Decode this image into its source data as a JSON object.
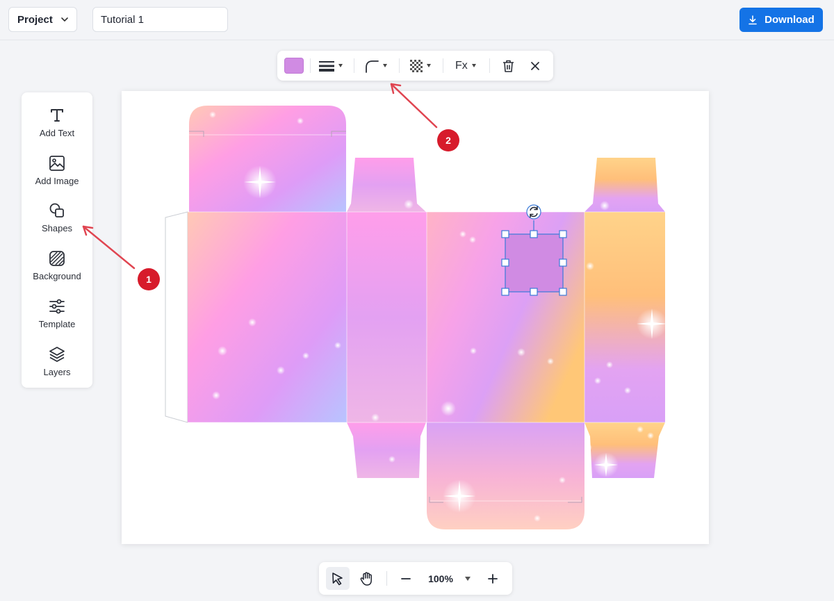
{
  "header": {
    "project_label": "Project",
    "title_value": "Tutorial 1",
    "download_label": "Download",
    "accent_color": "#1473e6"
  },
  "left_panel": {
    "items": [
      {
        "label": "Add Text",
        "icon": "text-icon"
      },
      {
        "label": "Add Image",
        "icon": "image-icon"
      },
      {
        "label": "Shapes",
        "icon": "shapes-icon"
      },
      {
        "label": "Background",
        "icon": "background-icon"
      },
      {
        "label": "Template",
        "icon": "sliders-icon"
      },
      {
        "label": "Layers",
        "icon": "layers-icon"
      }
    ]
  },
  "shape_toolbar": {
    "fill_color": "#d08be3",
    "fx_label": "Fx",
    "icons": [
      "fill-color-swatch",
      "stroke-width-icon",
      "corner-radius-icon",
      "opacity-icon",
      "fx-effects",
      "trash-icon",
      "close-icon"
    ]
  },
  "annotations": {
    "badge_1": "1",
    "badge_2": "2",
    "color": "#d71b2b"
  },
  "bottom_bar": {
    "zoom": "100%",
    "icons": [
      "select-pointer-icon",
      "hand-pan-icon",
      "zoom-out-icon",
      "zoom-dropdown-icon",
      "zoom-in-icon"
    ]
  },
  "canvas": {
    "selected_shape_color": "#d08be3",
    "template": "box-dieline"
  }
}
